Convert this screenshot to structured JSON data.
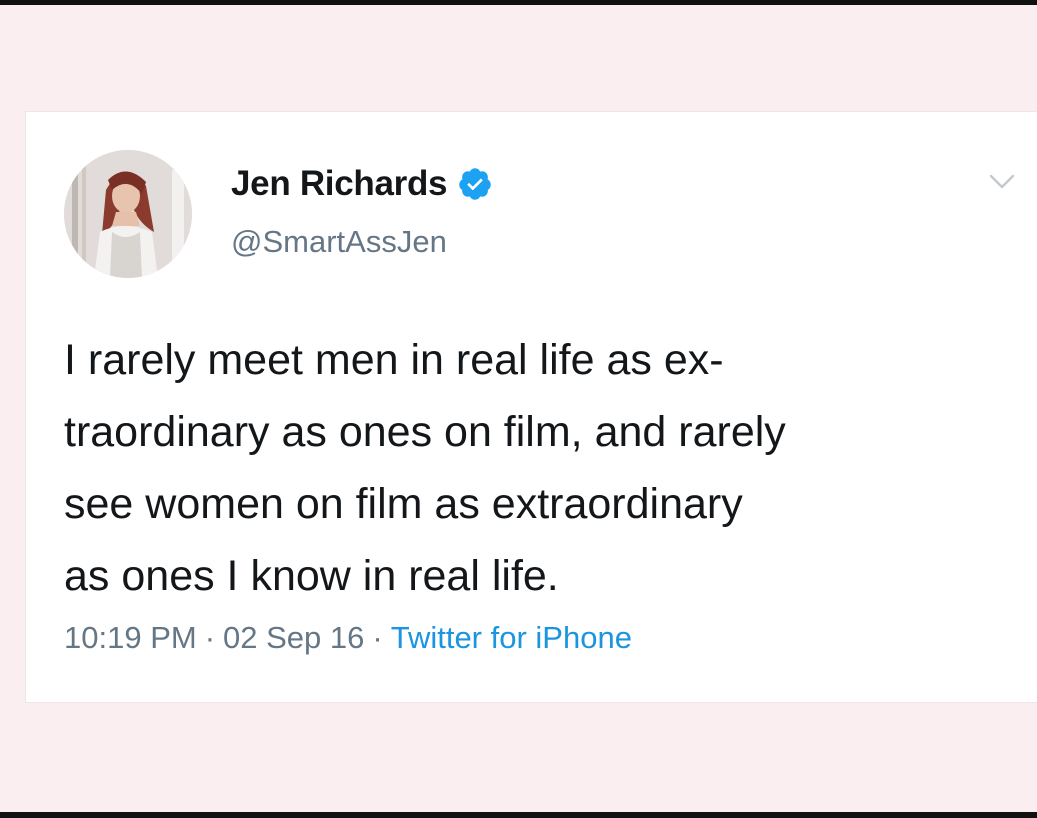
{
  "tweet": {
    "display_name": "Jen Richards",
    "handle": "@SmartAssJen",
    "verified": true,
    "text_lines": [
      "I rarely meet men in real life as ex-",
      "traordinary as ones on film, and rarely",
      "see women on film as extraordinary",
      "as ones I know in real life."
    ],
    "time": "10:19 PM",
    "date": "02 Sep 16",
    "separator": "·",
    "source": "Twitter for iPhone"
  },
  "icons": {
    "verified": "verified-badge-icon",
    "menu": "chevron-down-icon",
    "avatar": "profile-photo"
  },
  "colors": {
    "background": "#fbeef0",
    "card": "#ffffff",
    "text_primary": "#14171a",
    "text_secondary": "#657786",
    "link": "#1b95e0",
    "verified": "#1da1f2"
  }
}
